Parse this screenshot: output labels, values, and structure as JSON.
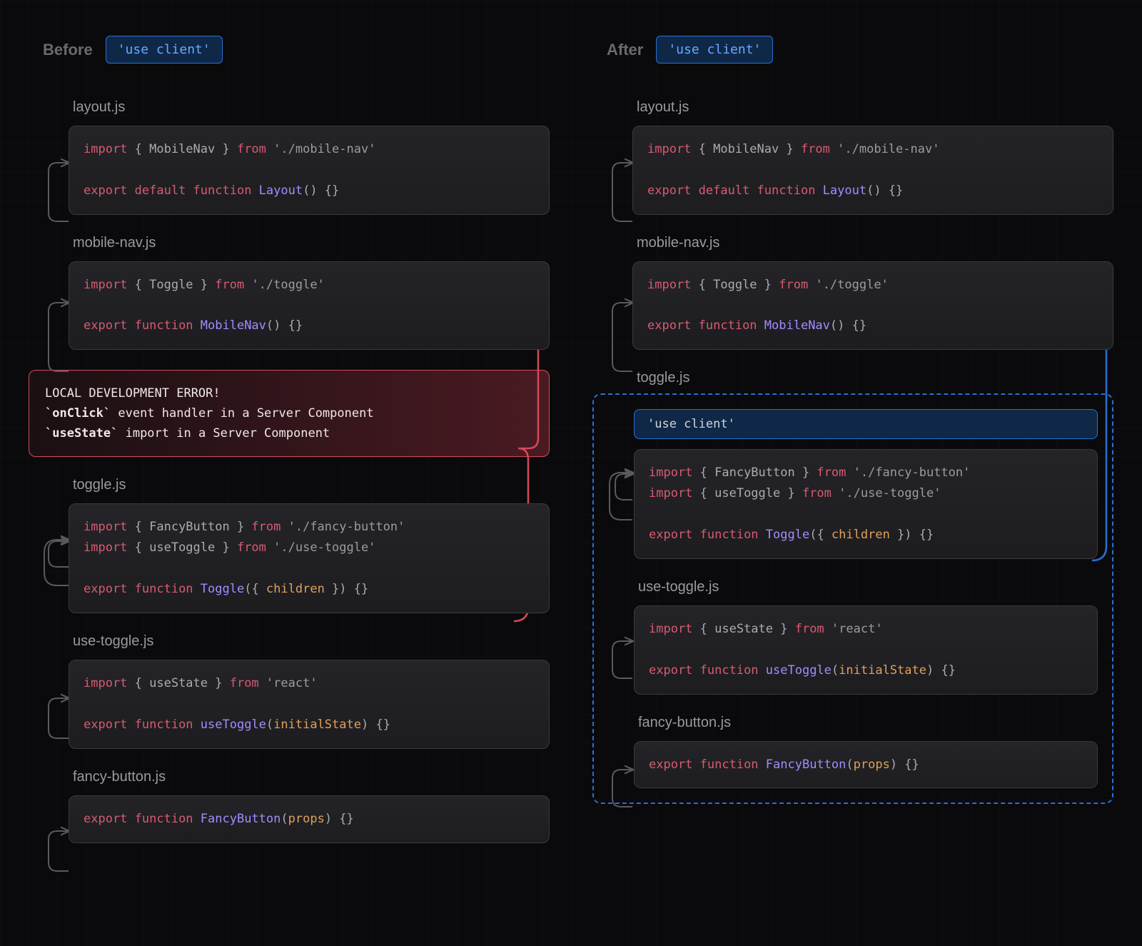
{
  "before": {
    "title": "Before",
    "directive": "'use client'",
    "files": {
      "layout": {
        "filename": "layout.js",
        "line1_import": "import",
        "line1_named": " { MobileNav } ",
        "line1_from": "from",
        "line1_path": " './mobile-nav'",
        "line3_export": "export",
        "line3_default": " default",
        "line3_function": " function",
        "line3_name": " Layout",
        "line3_sig": "() {}"
      },
      "mobilenav": {
        "filename": "mobile-nav.js",
        "line1_import": "import",
        "line1_named": " { Toggle } ",
        "line1_from": "from",
        "line1_path": " './toggle'",
        "line3_export": "export",
        "line3_function": " function",
        "line3_name": " MobileNav",
        "line3_sig": "() {}"
      },
      "toggle": {
        "filename": "toggle.js",
        "line1_import": "import",
        "line1_named": " { FancyButton } ",
        "line1_from": "from",
        "line1_path": " './fancy-button'",
        "line2_import": "import",
        "line2_named": " { useToggle } ",
        "line2_from": "from",
        "line2_path": " './use-toggle'",
        "line4_export": "export",
        "line4_function": " function",
        "line4_name": " Toggle",
        "line4_sig_open": "({ ",
        "line4_param": "children",
        "line4_sig_close": " }) {}"
      },
      "usetoggle": {
        "filename": "use-toggle.js",
        "line1_import": "import",
        "line1_named": " { useState } ",
        "line1_from": "from",
        "line1_path": " 'react'",
        "line3_export": "export",
        "line3_function": " function",
        "line3_name": " useToggle",
        "line3_sig_open": "(",
        "line3_param": "initialState",
        "line3_sig_close": ") {}"
      },
      "fancybutton": {
        "filename": "fancy-button.js",
        "line1_export": "export",
        "line1_function": " function",
        "line1_name": " FancyButton",
        "line1_sig_open": "(",
        "line1_param": "props",
        "line1_sig_close": ") {}"
      }
    },
    "error": {
      "title": "LOCAL DEVELOPMENT ERROR!",
      "item1_code": "`onClick`",
      "item1_text": " event handler in a Server Component",
      "item2_code": "`useState`",
      "item2_text": " import in a Server Component"
    }
  },
  "after": {
    "title": "After",
    "directive": "'use client'",
    "use_client_text": "'use client'",
    "files": {
      "layout": {
        "filename": "layout.js",
        "line1_import": "import",
        "line1_named": " { MobileNav } ",
        "line1_from": "from",
        "line1_path": " './mobile-nav'",
        "line3_export": "export",
        "line3_default": " default",
        "line3_function": " function",
        "line3_name": " Layout",
        "line3_sig": "() {}"
      },
      "mobilenav": {
        "filename": "mobile-nav.js",
        "line1_import": "import",
        "line1_named": " { Toggle } ",
        "line1_from": "from",
        "line1_path": " './toggle'",
        "line3_export": "export",
        "line3_function": " function",
        "line3_name": " MobileNav",
        "line3_sig": "() {}"
      },
      "toggle": {
        "filename": "toggle.js",
        "line1_import": "import",
        "line1_named": " { FancyButton } ",
        "line1_from": "from",
        "line1_path": " './fancy-button'",
        "line2_import": "import",
        "line2_named": " { useToggle } ",
        "line2_from": "from",
        "line2_path": " './use-toggle'",
        "line4_export": "export",
        "line4_function": " function",
        "line4_name": " Toggle",
        "line4_sig_open": "({ ",
        "line4_param": "children",
        "line4_sig_close": " }) {}"
      },
      "usetoggle": {
        "filename": "use-toggle.js",
        "line1_import": "import",
        "line1_named": " { useState } ",
        "line1_from": "from",
        "line1_path": " 'react'",
        "line3_export": "export",
        "line3_function": " function",
        "line3_name": " useToggle",
        "line3_sig_open": "(",
        "line3_param": "initialState",
        "line3_sig_close": ") {}"
      },
      "fancybutton": {
        "filename": "fancy-button.js",
        "line1_export": "export",
        "line1_function": " function",
        "line1_name": " FancyButton",
        "line1_sig_open": "(",
        "line1_param": "props",
        "line1_sig_close": ") {}"
      }
    }
  }
}
